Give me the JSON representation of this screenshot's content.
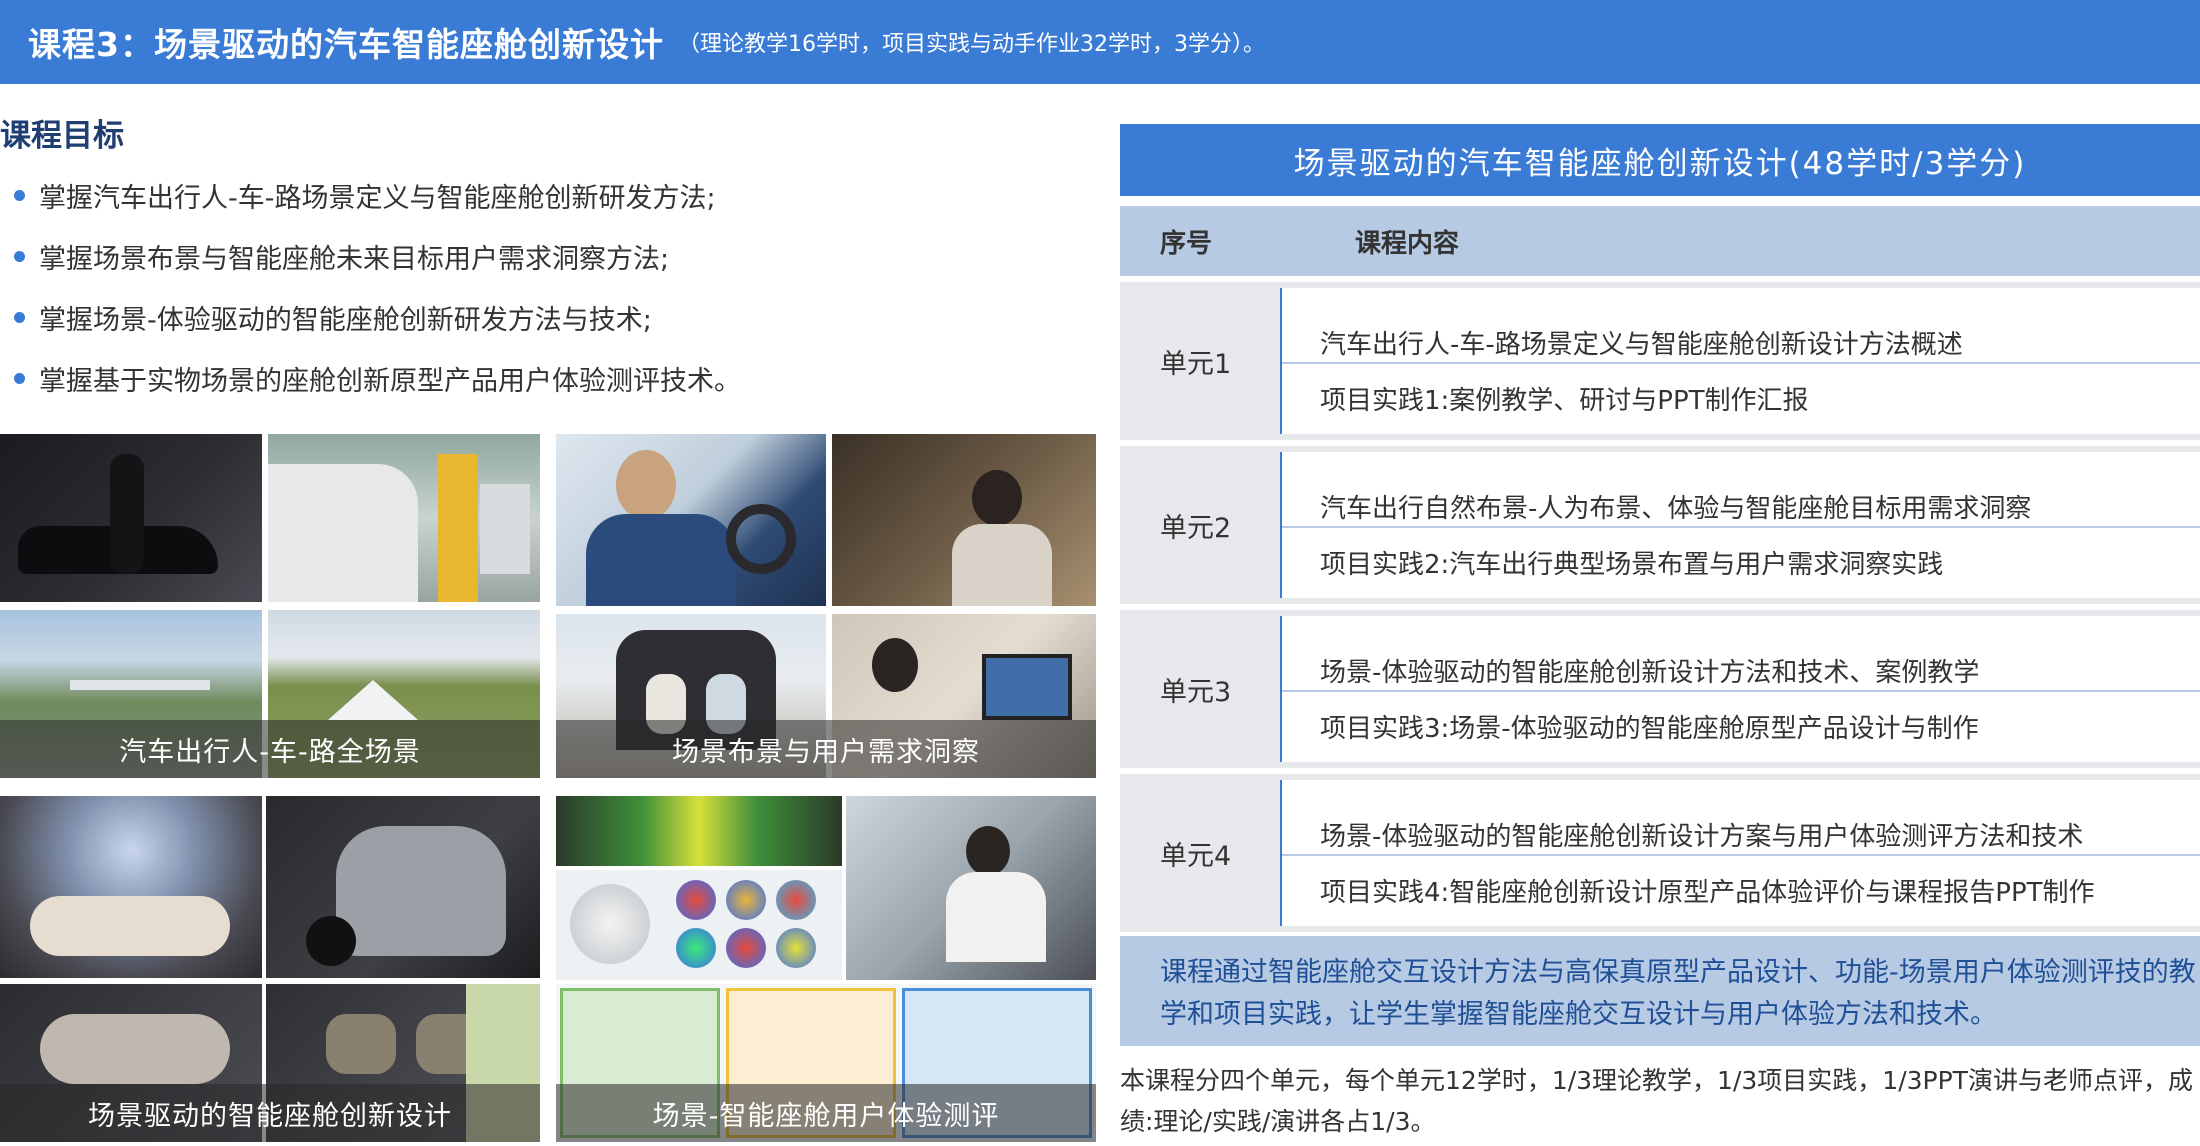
{
  "header": {
    "title": "课程3：场景驱动的汽车智能座舱创新设计",
    "subtitle": "（理论教学16学时，项目实践与动手作业32学时，3学分）。"
  },
  "goals": {
    "title": "课程目标",
    "items": [
      "掌握汽车出行人-车-路场景定义与智能座舱创新研发方法;",
      "掌握场景布景与智能座舱未来目标用户需求洞察方法;",
      "掌握场景-体验驱动的智能座舱创新研发方法与技术;",
      "掌握基于实物场景的座舱创新原型产品用户体验测评技术。"
    ]
  },
  "photos": [
    {
      "caption": "汽车出行人-车-路全场景"
    },
    {
      "caption": "场景布景与用户需求洞察"
    },
    {
      "caption": "场景驱动的智能座舱创新设计"
    },
    {
      "caption": "场景-智能座舱用户体验测评"
    }
  ],
  "table": {
    "title": "场景驱动的汽车智能座舱创新设计(48学时/3学分)",
    "col_no": "序号",
    "col_content": "课程内容",
    "units": [
      {
        "label": "单元1",
        "line1": "汽车出行人-车-路场景定义与智能座舱创新设计方法概述",
        "line2": "项目实践1:案例教学、研讨与PPT制作汇报"
      },
      {
        "label": "单元2",
        "line1": "汽车出行自然布景-人为布景、体验与智能座舱目标用需求洞察",
        "line2": "项目实践2:汽车出行典型场景布置与用户需求洞察实践"
      },
      {
        "label": "单元3",
        "line1": "场景-体验驱动的智能座舱创新设计方法和技术、案例教学",
        "line2": "项目实践3:场景-体验驱动的智能座舱原型产品设计与制作"
      },
      {
        "label": "单元4",
        "line1": "场景-体验驱动的智能座舱创新设计方案与用户体验测评方法和技术",
        "line2": "项目实践4:智能座舱创新设计原型产品体验评价与课程报告PPT制作"
      }
    ],
    "summary": "课程通过智能座舱交互设计方法与高保真原型产品设计、功能-场景用户体验测评技的教学和项目实践，让学生掌握智能座舱交互设计与用户体验方法和技术。",
    "note": "本课程分四个单元，每个单元12学时，1/3理论教学，1/3项目实践，1/3PPT演讲与老师点评，成绩:理论/实践/演讲各占1/3。"
  },
  "colors": {
    "accent": "#3a7bd5",
    "header_row": "#b7cae3",
    "unit_bg": "#e6e8ec",
    "summary_text": "#1f4f96"
  }
}
